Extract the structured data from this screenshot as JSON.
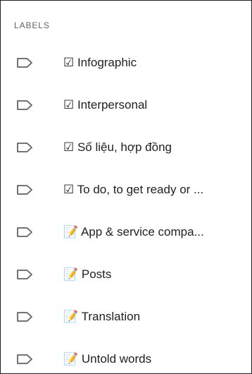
{
  "sidebar": {
    "section_title": "LABELS",
    "label_icon": "label-tag-icon",
    "items": [
      {
        "label": "☑ Infographic"
      },
      {
        "label": "☑ Interpersonal"
      },
      {
        "label": "☑ Số liệu, hợp đồng"
      },
      {
        "label": "☑ To do, to get ready or ..."
      },
      {
        "label": "📝 App & service compa..."
      },
      {
        "label": "📝 Posts"
      },
      {
        "label": "📝 Translation"
      },
      {
        "label": "📝 Untold words"
      }
    ]
  },
  "colors": {
    "border": "#202124",
    "text": "#202124",
    "header_text": "#5f6368",
    "icon_stroke": "#5f6368",
    "background": "#ffffff"
  }
}
